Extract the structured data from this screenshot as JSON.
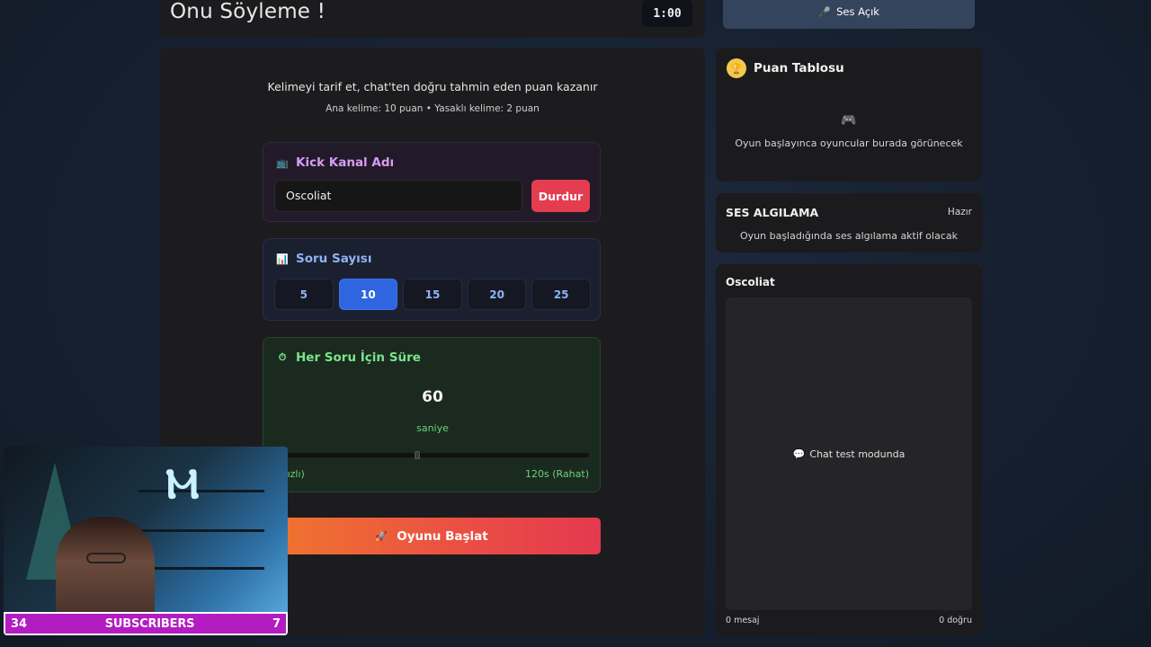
{
  "header": {
    "title": "Onu Söyleme !",
    "timer": "1:00"
  },
  "intro": {
    "line1": "Kelimeyi tarif et, chat'ten doğru tahmin eden puan kazanır",
    "line2": "Ana kelime: 10 puan • Yasaklı kelime: 2 puan"
  },
  "kick": {
    "title": "Kick Kanal Adı",
    "icon": "tv-icon",
    "value": "Oscoliat",
    "stop_label": "Durdur"
  },
  "question_count": {
    "title": "Soru Sayısı",
    "icon": "bar-chart-icon",
    "options": [
      "5",
      "10",
      "15",
      "20",
      "25"
    ],
    "selected": "10"
  },
  "time": {
    "title": "Her Soru İçin Süre",
    "icon": "stopwatch-icon",
    "value": "60",
    "unit": "saniye",
    "slider_fraction": 0.45,
    "min_label": "(Hızlı)",
    "max_label": "120s (Rahat)"
  },
  "start": {
    "label": "Oyunu Başlat",
    "icon": "rocket-icon"
  },
  "sound": {
    "label": "Ses Açık",
    "icon": "microphone-icon"
  },
  "scoreboard": {
    "title": "Puan Tablosu",
    "icon": "trophy-icon",
    "empty_icon": "gamepad-icon",
    "empty_text": "Oyun başlayınca oyuncular burada görünecek"
  },
  "sound_detect": {
    "title": "SES ALGILAMA",
    "status": "Hazır",
    "description": "Oyun başladığında ses algılama aktif olacak"
  },
  "chat": {
    "title": "Oscoliat",
    "placeholder": "Chat test modunda",
    "icon": "speech-bubble-icon",
    "messages": "0 mesaj",
    "correct": "0 doğru"
  },
  "webcam": {
    "left_count": "34",
    "label": "SUBSCRIBERS",
    "right_count": "7"
  },
  "colors": {
    "accent_blue": "#2f66df",
    "stop_red": "#e43d4f",
    "green": "#6ad27d",
    "purple": "#d79cf2",
    "subscriber_bar": "#b31cc1"
  }
}
